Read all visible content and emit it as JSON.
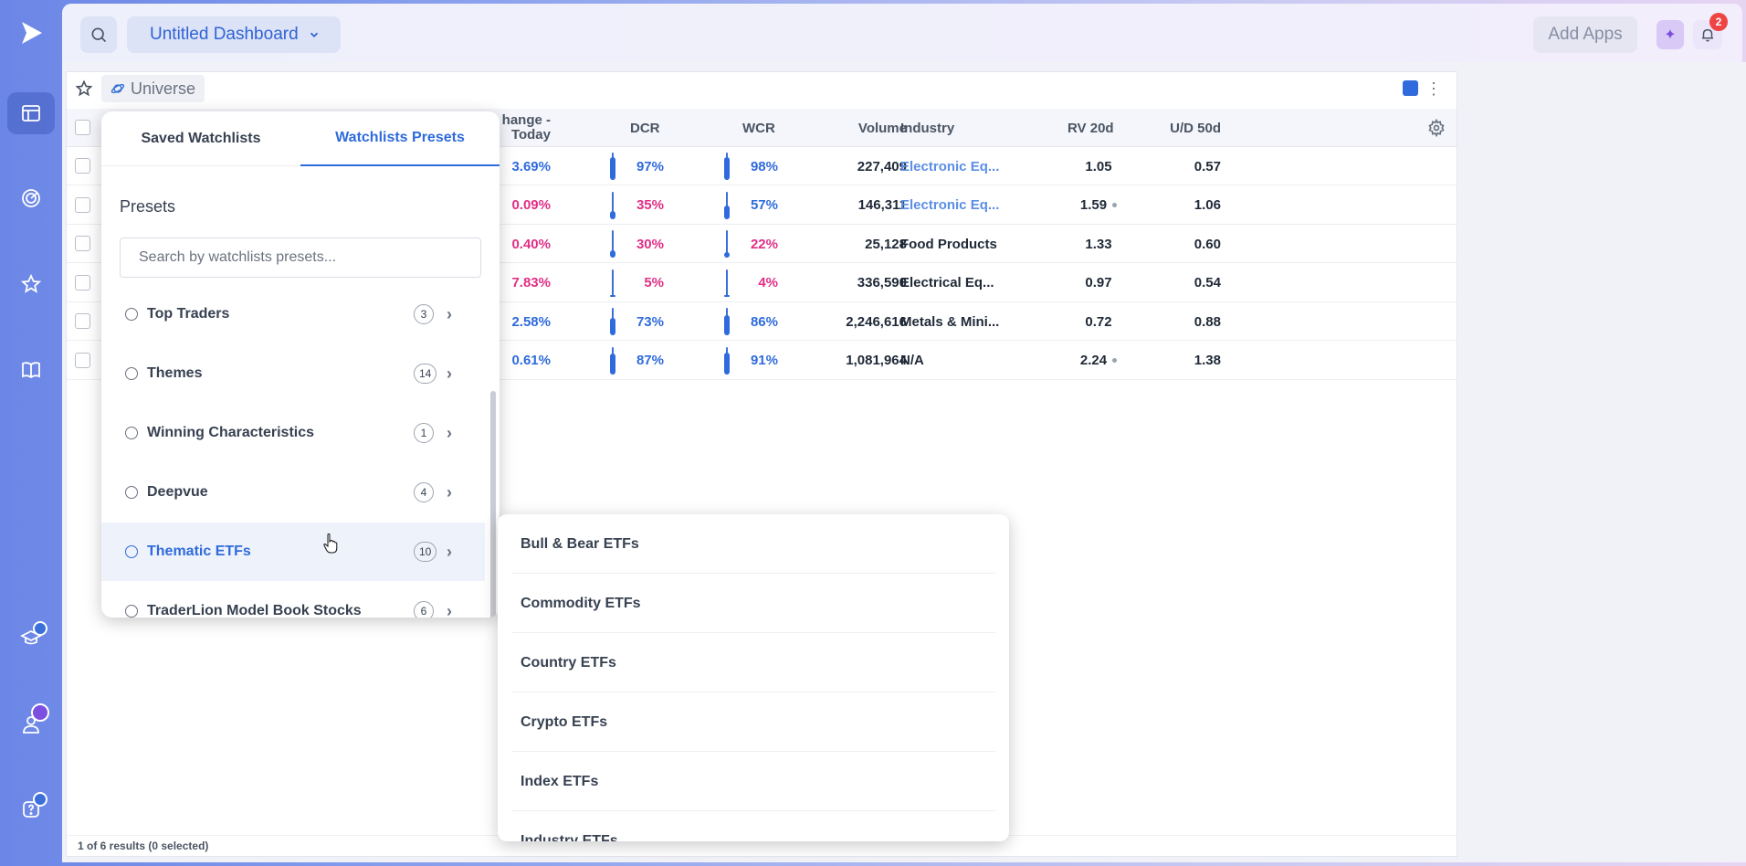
{
  "header": {
    "dashboard_title": "Untitled Dashboard",
    "add_apps_label": "Add Apps",
    "notification_count": "2"
  },
  "panel": {
    "universe_label": "Universe",
    "footer_text": "1 of 6 results (0 selected)"
  },
  "table": {
    "columns": [
      "hange -\nToday",
      "DCR",
      "WCR",
      "Volume",
      "Industry",
      "RV 20d",
      "U/D 50d"
    ],
    "change_header_line1": "hange -",
    "change_header_line2": "Today",
    "rows": [
      {
        "change": "3.69%",
        "change_dir": "pos",
        "dcr": "97%",
        "dcr_dir": "pos",
        "dcr_level": 0.97,
        "wcr": "98%",
        "wcr_dir": "pos",
        "wcr_level": 0.98,
        "volume": "227,409",
        "industry": "Electronic Eq...",
        "industry_link": true,
        "rv": "1.05",
        "rv_dot": false,
        "ud": "0.57"
      },
      {
        "change": "0.09%",
        "change_dir": "neg",
        "dcr": "35%",
        "dcr_dir": "neg",
        "dcr_level": 0.35,
        "wcr": "57%",
        "wcr_dir": "pos",
        "wcr_level": 0.57,
        "volume": "146,311",
        "industry": "Electronic Eq...",
        "industry_link": true,
        "rv": "1.59",
        "rv_dot": true,
        "ud": "1.06"
      },
      {
        "change": "0.40%",
        "change_dir": "neg",
        "dcr": "30%",
        "dcr_dir": "neg",
        "dcr_level": 0.3,
        "wcr": "22%",
        "wcr_dir": "neg",
        "wcr_level": 0.22,
        "volume": "25,128",
        "industry": "Food Products",
        "industry_link": false,
        "rv": "1.33",
        "rv_dot": false,
        "ud": "0.60"
      },
      {
        "change": "7.83%",
        "change_dir": "neg",
        "dcr": "5%",
        "dcr_dir": "neg",
        "dcr_level": 0.05,
        "wcr": "4%",
        "wcr_dir": "neg",
        "wcr_level": 0.04,
        "volume": "336,590",
        "industry": "Electrical Eq...",
        "industry_link": false,
        "rv": "0.97",
        "rv_dot": false,
        "ud": "0.54"
      },
      {
        "change": "2.58%",
        "change_dir": "pos",
        "dcr": "73%",
        "dcr_dir": "pos",
        "dcr_level": 0.73,
        "wcr": "86%",
        "wcr_dir": "pos",
        "wcr_level": 0.86,
        "volume": "2,246,616",
        "industry": "Metals & Mini...",
        "industry_link": false,
        "rv": "0.72",
        "rv_dot": false,
        "ud": "0.88"
      },
      {
        "change": "0.61%",
        "change_dir": "pos",
        "dcr": "87%",
        "dcr_dir": "pos",
        "dcr_level": 0.87,
        "wcr": "91%",
        "wcr_dir": "pos",
        "wcr_level": 0.91,
        "volume": "1,081,964",
        "industry": "N/A",
        "industry_link": false,
        "rv": "2.24",
        "rv_dot": true,
        "ud": "1.38"
      }
    ]
  },
  "dropdown": {
    "tab_saved": "Saved Watchlists",
    "tab_presets": "Watchlists Presets",
    "presets_title": "Presets",
    "search_placeholder": "Search by watchlists presets...",
    "items": [
      {
        "label": "Top Traders",
        "count": "3"
      },
      {
        "label": "Themes",
        "count": "14"
      },
      {
        "label": "Winning Characteristics",
        "count": "1"
      },
      {
        "label": "Deepvue",
        "count": "4"
      },
      {
        "label": "Thematic ETFs",
        "count": "10"
      },
      {
        "label": "TraderLion Model Book Stocks",
        "count": "6"
      }
    ]
  },
  "submenu": {
    "items": [
      "Bull & Bear ETFs",
      "Commodity ETFs",
      "Country ETFs",
      "Crypto ETFs",
      "Index ETFs",
      "Industry ETFs"
    ]
  },
  "colors": {
    "accent": "#2f6bdc",
    "positive": "#2f6bdc",
    "negative": "#e12f86",
    "badge": "#ef4444"
  }
}
